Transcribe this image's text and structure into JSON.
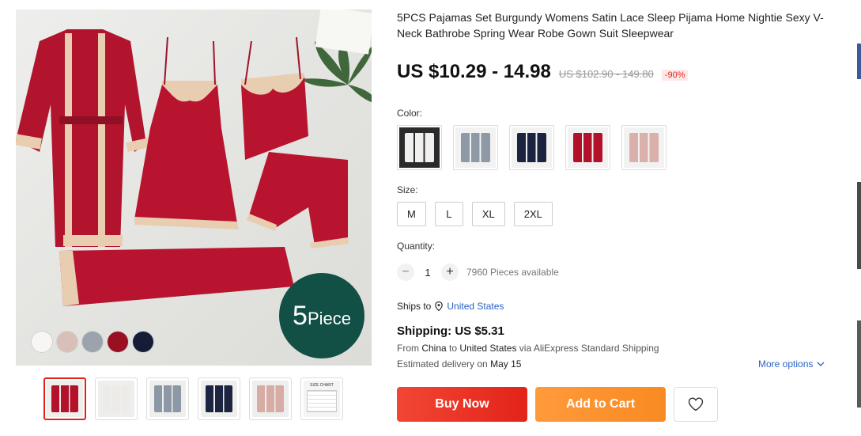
{
  "product": {
    "title": "5PCS Pajamas Set Burgundy Womens Satin Lace Sleep Pijama Home Nightie Sexy V-Neck Bathrobe Spring Wear Robe Gown Suit Sleepwear",
    "price": "US $10.29 - 14.98",
    "original_price": "US $102.90 - 149.80",
    "discount": "-90%",
    "badge_number": "5",
    "badge_word": "Piece"
  },
  "image_swatches": [
    {
      "name": "white",
      "color": "#f7f6f4"
    },
    {
      "name": "pink",
      "color": "#d8bfb7"
    },
    {
      "name": "gray",
      "color": "#9aa3ae"
    },
    {
      "name": "burgundy",
      "color": "#9b0f22"
    },
    {
      "name": "navy",
      "color": "#141c38"
    }
  ],
  "thumbnails": [
    {
      "name": "burgundy",
      "color": "#b4122a",
      "active": true
    },
    {
      "name": "white",
      "color": "#ecebe8",
      "active": false
    },
    {
      "name": "gray",
      "color": "#8c98a6",
      "active": false
    },
    {
      "name": "navy",
      "color": "#1d2442",
      "active": false
    },
    {
      "name": "pink",
      "color": "#d6aca4",
      "active": false
    },
    {
      "name": "size-chart",
      "color": "#f4f4f4",
      "label": "SIZE CHART",
      "active": false
    }
  ],
  "color": {
    "label": "Color:",
    "options": [
      {
        "name": "white",
        "color": "#f1f0ee",
        "bg": "#2b2b2b"
      },
      {
        "name": "gray",
        "color": "#8e99a6",
        "bg": "#f2f2f2"
      },
      {
        "name": "navy",
        "color": "#1c2340",
        "bg": "#f2f2f2"
      },
      {
        "name": "burgundy",
        "color": "#b3102a",
        "bg": "#f2f2f2"
      },
      {
        "name": "pink",
        "color": "#d9b1aa",
        "bg": "#f2f2f2"
      }
    ]
  },
  "size": {
    "label": "Size:",
    "options": [
      "M",
      "L",
      "XL",
      "2XL"
    ]
  },
  "quantity": {
    "label": "Quantity:",
    "minus": "−",
    "plus": "+",
    "value": "1",
    "available": "7960 Pieces available"
  },
  "shipping": {
    "ships_to_label": "Ships to",
    "ships_to_country": "United States",
    "price": "Shipping: US $5.31",
    "from_label": "From",
    "from_country": "China",
    "to_label": "to",
    "to_country": "United States",
    "via_label": "via",
    "carrier": "AliExpress Standard Shipping",
    "delivery_label": "Estimated delivery on",
    "delivery_date": "May 15",
    "more_options": "More options"
  },
  "actions": {
    "buy_now": "Buy Now",
    "add_to_cart": "Add to Cart"
  },
  "icons": {
    "location": "location-pin-icon",
    "chevron": "chevron-down-icon",
    "wishlist": "heart-icon"
  }
}
